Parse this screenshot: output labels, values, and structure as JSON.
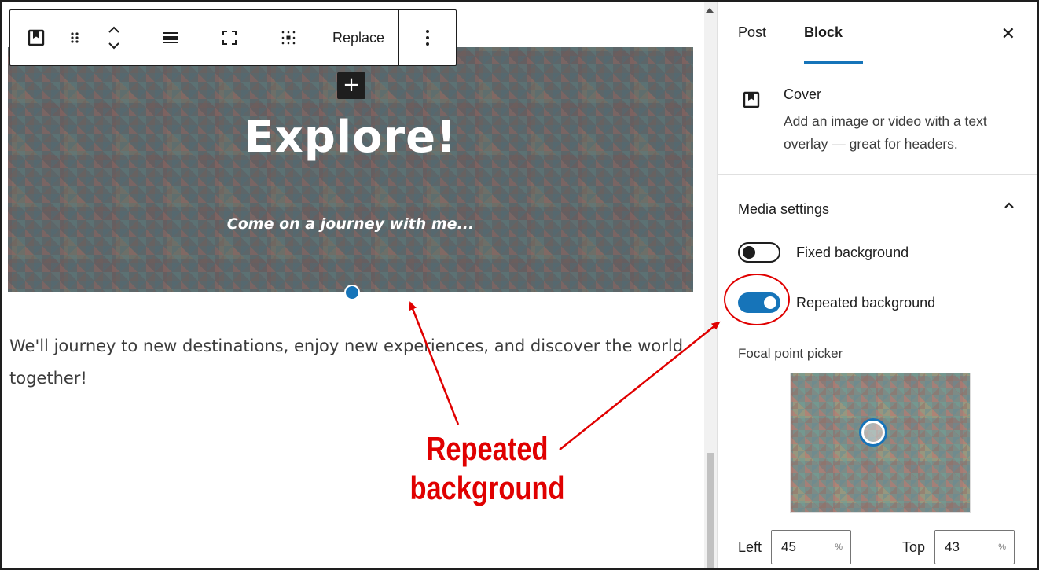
{
  "toolbar": {
    "replace_label": "Replace",
    "icons": [
      "cover-block-icon",
      "drag-handle-icon",
      "move-up-down-icon",
      "align-icon",
      "fullscreen-icon",
      "content-position-icon",
      "more-options-icon"
    ]
  },
  "cover": {
    "title": "Explore!",
    "subtitle": "Come on a journey with me...",
    "inserter_label": "+"
  },
  "content": {
    "paragraph": "We'll journey to new destinations, enjoy new experiences, and discover the world together!"
  },
  "sidebar": {
    "tabs": [
      {
        "label": "Post",
        "active": false
      },
      {
        "label": "Block",
        "active": true
      }
    ],
    "close_label": "✕",
    "block": {
      "name": "Cover",
      "description": "Add an image or video with a text overlay — great for headers."
    },
    "media_settings": {
      "title": "Media settings",
      "fixed_background": {
        "label": "Fixed background",
        "checked": false
      },
      "repeated_background": {
        "label": "Repeated background",
        "checked": true
      },
      "focal_point_label": "Focal point picker",
      "left": {
        "label": "Left",
        "value": "45",
        "unit": "%"
      },
      "top": {
        "label": "Top",
        "value": "43",
        "unit": "%"
      }
    }
  },
  "annotation": {
    "line1": "Repeated",
    "line2": "background",
    "color": "#e00000"
  },
  "colors": {
    "accent": "#1674b9",
    "text": "#1e1e1e"
  }
}
